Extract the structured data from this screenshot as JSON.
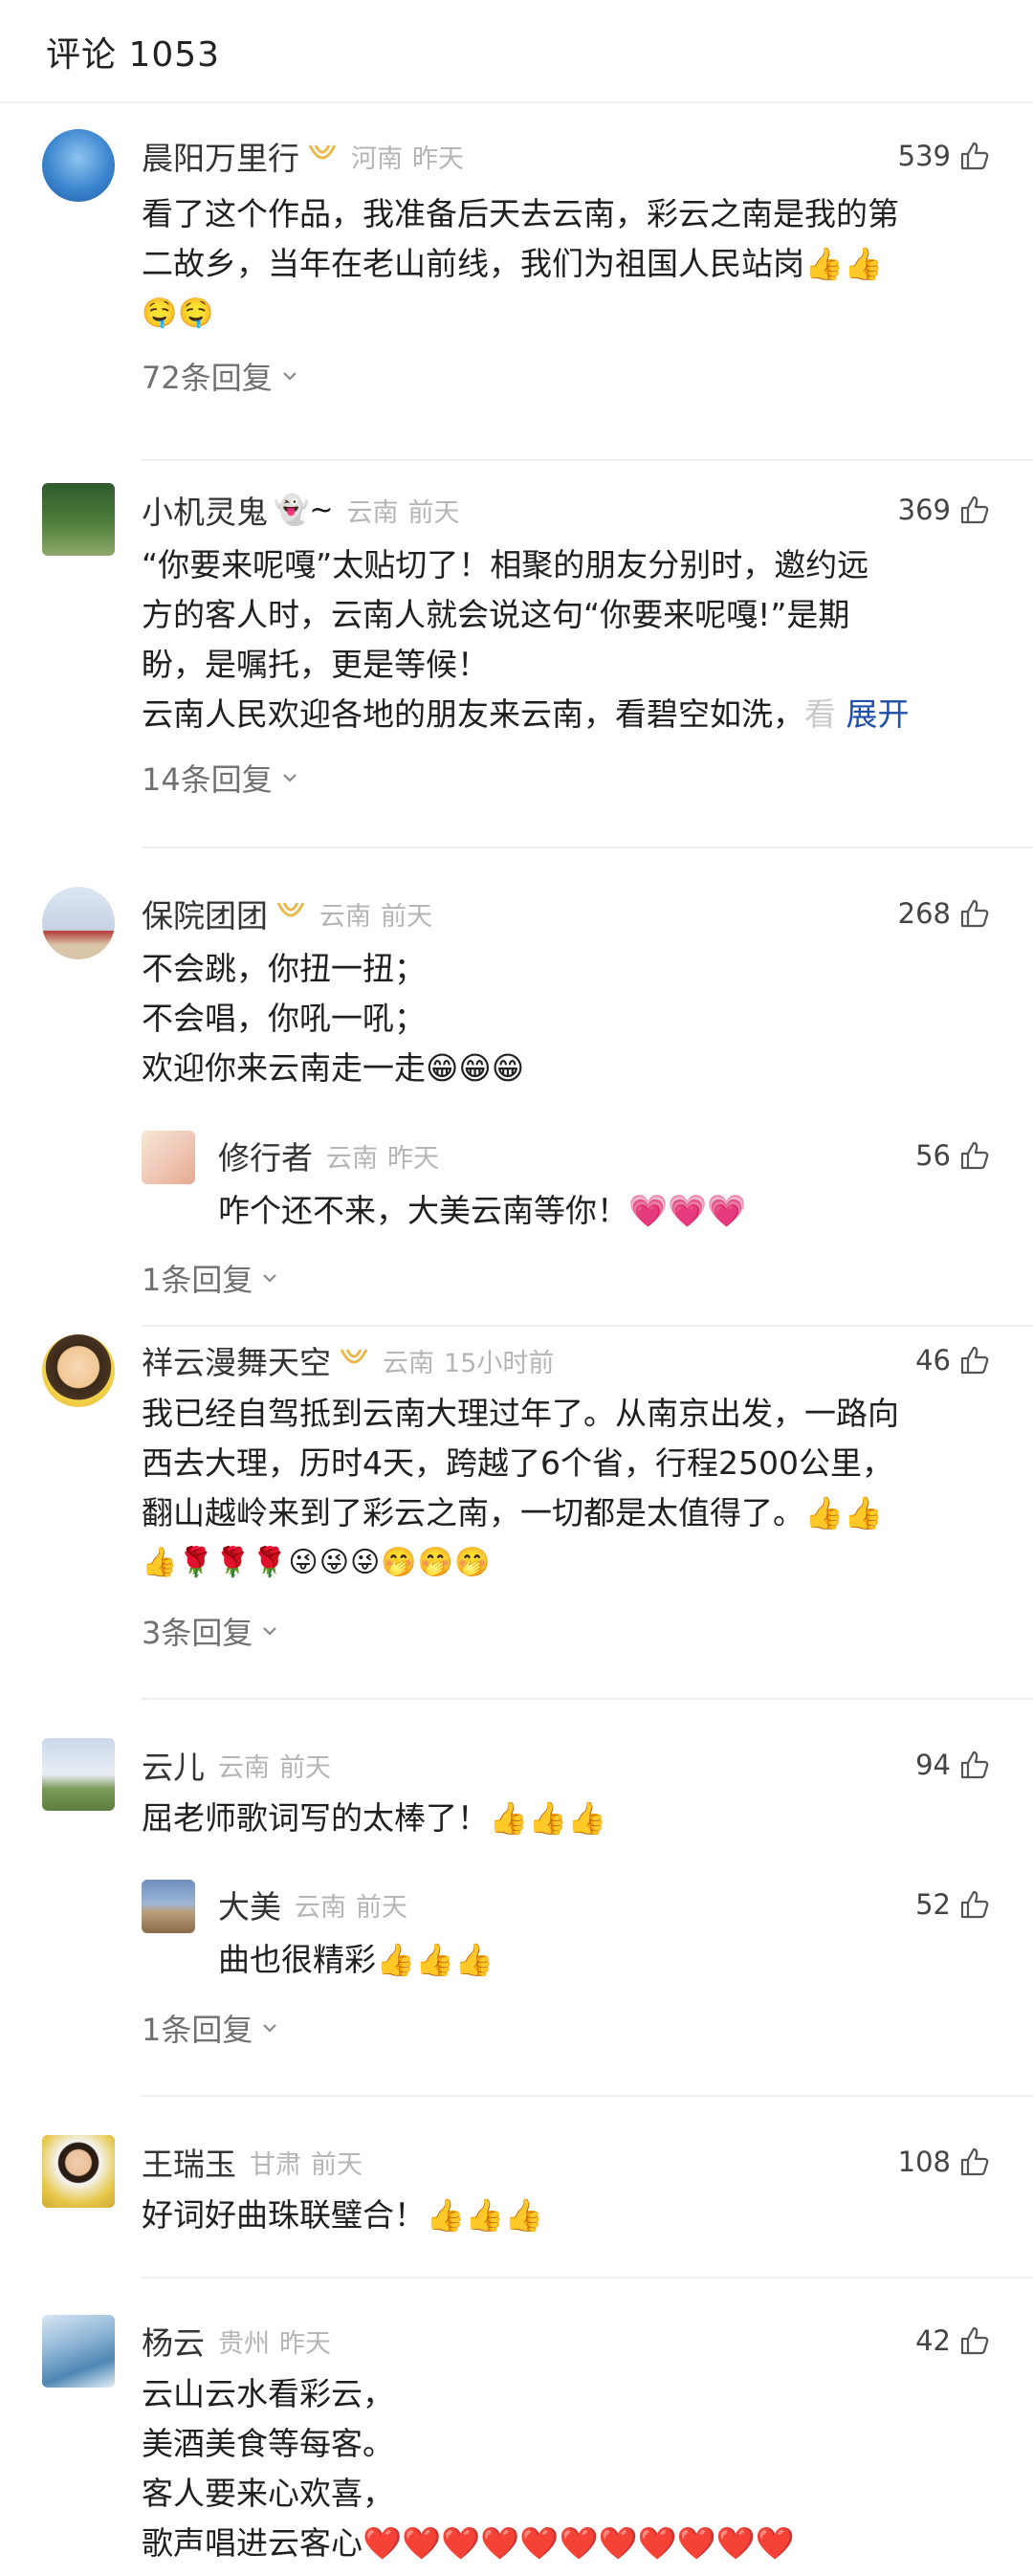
{
  "header": {
    "title": "评论 1053"
  },
  "comments": [
    {
      "user": "晨阳万里行",
      "location": "河南",
      "time": "昨天",
      "likes": "539",
      "lines": [
        "看了这个作品，我准备后天去云南，彩云之南是我的第",
        "二故乡，当年在老山前线，我们为祖国人民站岗👍👍",
        "🤤🤤"
      ],
      "replies": "72条回复"
    },
    {
      "user": "小机灵鬼",
      "user_suffix": "👻~",
      "location": "云南",
      "time": "前天",
      "likes": "369",
      "lines": [
        "“你要来呢嘎”太贴切了！相聚的朋友分别时，邀约远",
        "方的客人时，云南人就会说这句“你要来呢嘎!”是期",
        "盼，是嘱托，更是等候！"
      ],
      "line_last": "云南人民欢迎各地的朋友来云南，看碧空如洗，",
      "line_fade": "看",
      "expand": "展开",
      "replies": "14条回复"
    },
    {
      "user": "保院团团",
      "location": "云南",
      "time": "前天",
      "likes": "268",
      "lines": [
        "不会跳，你扭一扭；",
        "不会唱，你吼一吼；",
        "欢迎你来云南走一走😁😁😁"
      ],
      "sub": {
        "user": "修行者",
        "location": "云南",
        "time": "昨天",
        "likes": "56",
        "text": "咋个还不来，大美云南等你！💗💗💗"
      },
      "replies": "1条回复"
    },
    {
      "user": "祥云漫舞天空",
      "location": "云南",
      "time": "15小时前",
      "likes": "46",
      "lines": [
        "我已经自驾抵到云南大理过年了。从南京出发，一路向",
        "西去大理，历时4天，跨越了6个省，行程2500公里，",
        "翻山越岭来到了彩云之南，一切都是太值得了。👍👍",
        "👍🌹🌹🌹😜😜😜🤭🤭🤭"
      ],
      "replies": "3条回复"
    },
    {
      "user": "云儿",
      "location": "云南",
      "time": "前天",
      "likes": "94",
      "lines": [
        "屈老师歌词写的太棒了！👍👍👍"
      ],
      "sub": {
        "user": "大美",
        "location": "云南",
        "time": "前天",
        "likes": "52",
        "text": "曲也很精彩👍👍👍"
      },
      "replies": "1条回复"
    },
    {
      "user": "王瑞玉",
      "location": "甘肃",
      "time": "前天",
      "likes": "108",
      "lines": [
        "好词好曲珠联璧合！👍👍👍"
      ]
    },
    {
      "user": "杨云",
      "location": "贵州",
      "time": "昨天",
      "likes": "42",
      "lines": [
        "云山云水看彩云，",
        "美酒美食等每客。",
        "客人要来心欢喜，",
        "歌声唱进云客心❤️❤️❤️❤️❤️❤️❤️❤️❤️❤️❤️"
      ]
    }
  ],
  "colors": {
    "accent_link": "#1d4fa8",
    "badge_gold": "#e8b94a",
    "meta_gray": "#b5b5b5"
  }
}
